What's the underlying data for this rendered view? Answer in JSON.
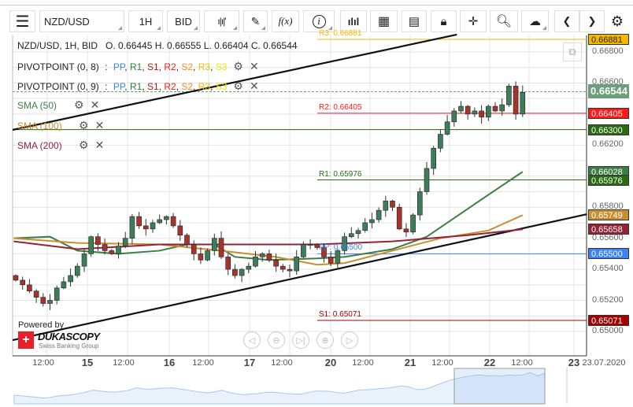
{
  "toolbar": {
    "symbol": "NZD/USD",
    "timeframe": "1H",
    "side": "BID",
    "fx": "f(x)",
    "info": "i",
    "prev": "❮",
    "next": "❯"
  },
  "legend": {
    "ohlc": "NZD/USD, 1H, BID   O. 0.66445 H. 0.66555 L. 0.66404 C. 0.66544",
    "pivots": [
      {
        "name": "PIVOTPOINT (0, 8)",
        "sep": " : ",
        "parts": [
          {
            "t": "PP",
            "c": "#3b82f6"
          },
          {
            "t": "R1",
            "c": "#2e7d32"
          },
          {
            "t": "S1",
            "c": "#b71c1c"
          },
          {
            "t": "R2",
            "c": "#ff1a1a"
          },
          {
            "t": "S2",
            "c": "#ff8c1a"
          },
          {
            "t": "R3",
            "c": "#f5b800"
          },
          {
            "t": "S3",
            "c": "#f2e600"
          }
        ]
      },
      {
        "name": "PIVOTPOINT (0, 9)",
        "sep": " : ",
        "parts": [
          {
            "t": "PP",
            "c": "#3b82f6"
          },
          {
            "t": "R1",
            "c": "#2e7d32"
          },
          {
            "t": "S1",
            "c": "#b71c1c"
          },
          {
            "t": "R2",
            "c": "#ff1a1a"
          },
          {
            "t": "S2",
            "c": "#ff8c1a"
          },
          {
            "t": "R3",
            "c": "#f5b800"
          },
          {
            "t": "S3",
            "c": "#f2e600"
          }
        ]
      }
    ],
    "smas": [
      {
        "label": "SMA (50)",
        "color": "#3e7d46"
      },
      {
        "label": "SMA (100)",
        "color": "#c98f2e"
      },
      {
        "label": "SMA (200)",
        "color": "#962235"
      }
    ]
  },
  "branding": {
    "powered": "Powered by",
    "brand": "DUKASCOPY",
    "tagline": "Swiss Banking Group"
  },
  "chart_data": {
    "type": "candlestick",
    "symbol": "NZD/USD",
    "timeframe": "1H",
    "side": "BID",
    "ylim": [
      0.649,
      0.6695
    ],
    "y_ticks": [
      "0.66800",
      "0.66600",
      "0.66200",
      "0.65800",
      "0.65600",
      "0.65400",
      "0.65200",
      "0.65000"
    ],
    "y_tick_values": [
      0.668,
      0.666,
      0.662,
      0.658,
      0.656,
      0.654,
      0.652,
      0.65
    ],
    "x_ticks": [
      {
        "t": "12:00",
        "d": false
      },
      {
        "t": "15",
        "d": true
      },
      {
        "t": "12:00",
        "d": false
      },
      {
        "t": "16",
        "d": true
      },
      {
        "t": "12:00",
        "d": false
      },
      {
        "t": "17",
        "d": true
      },
      {
        "t": "12:00",
        "d": false
      },
      {
        "t": "20",
        "d": true
      },
      {
        "t": "12:00",
        "d": false
      },
      {
        "t": "21",
        "d": true
      },
      {
        "t": "12:00",
        "d": false
      },
      {
        "t": "22",
        "d": true
      },
      {
        "t": "12:00",
        "d": false
      },
      {
        "t": "23",
        "d": true
      }
    ],
    "date_label": "23.07.2020",
    "closes": [
      0.6533,
      0.653,
      0.6526,
      0.6522,
      0.6518,
      0.652,
      0.6528,
      0.6532,
      0.6536,
      0.6542,
      0.655,
      0.6561,
      0.6556,
      0.6552,
      0.655,
      0.6555,
      0.656,
      0.6574,
      0.6568,
      0.6566,
      0.657,
      0.6572,
      0.6574,
      0.6568,
      0.6562,
      0.6556,
      0.655,
      0.6546,
      0.6552,
      0.656,
      0.6548,
      0.654,
      0.6536,
      0.654,
      0.6542,
      0.6548,
      0.655,
      0.6546,
      0.6542,
      0.654,
      0.6539,
      0.6548,
      0.6556,
      0.6556,
      0.6554,
      0.6548,
      0.6544,
      0.6552,
      0.6561,
      0.6563,
      0.6565,
      0.657,
      0.6572,
      0.6578,
      0.6584,
      0.658,
      0.6566,
      0.6564,
      0.6575,
      0.659,
      0.6605,
      0.6618,
      0.6627,
      0.6635,
      0.6642,
      0.6645,
      0.664,
      0.6642,
      0.6638,
      0.6645,
      0.6642,
      0.6646,
      0.6658,
      0.664,
      0.6654
    ],
    "last_price": "0.66544",
    "sma": [
      {
        "name": "SMA (50)",
        "color": "#3e7d46",
        "points": [
          [
            -0.3,
            0.656
          ],
          [
            5,
            0.6561
          ],
          [
            9,
            0.6552
          ],
          [
            15,
            0.655
          ],
          [
            21,
            0.6552
          ],
          [
            25,
            0.6556
          ],
          [
            29,
            0.6556
          ],
          [
            32,
            0.6548
          ],
          [
            37,
            0.6546
          ],
          [
            44,
            0.6547
          ],
          [
            48,
            0.6548
          ],
          [
            55,
            0.6553
          ],
          [
            60,
            0.6561
          ],
          [
            64,
            0.6573
          ],
          [
            69,
            0.6588
          ],
          [
            74,
            0.66028
          ]
        ]
      },
      {
        "name": "SMA (100)",
        "color": "#c98f2e",
        "points": [
          [
            -0.3,
            0.656
          ],
          [
            9,
            0.6557
          ],
          [
            21,
            0.6556
          ],
          [
            30,
            0.6552
          ],
          [
            38,
            0.6548
          ],
          [
            44,
            0.6543
          ],
          [
            48,
            0.6544
          ],
          [
            55,
            0.6552
          ],
          [
            62,
            0.656
          ],
          [
            69,
            0.6565
          ],
          [
            74,
            0.65749
          ]
        ]
      },
      {
        "name": "SMA (200)",
        "color": "#962235",
        "points": [
          [
            -0.3,
            0.6558
          ],
          [
            9,
            0.6553
          ],
          [
            21,
            0.6556
          ],
          [
            33,
            0.6556
          ],
          [
            44,
            0.6556
          ],
          [
            55,
            0.6558
          ],
          [
            66,
            0.6562
          ],
          [
            74,
            0.65658
          ]
        ]
      }
    ],
    "trendlines": [
      {
        "points": [
          [
            -0.46,
            0.66298
          ],
          [
            64.4,
            0.66912
          ]
        ]
      },
      {
        "points": [
          [
            -0.46,
            0.64944
          ],
          [
            83.4,
            0.65755
          ]
        ]
      }
    ],
    "levels": [
      {
        "label": "R3: 0.66881",
        "value": 0.66881,
        "badge": "0.66881",
        "color": "#f5b800",
        "text": "#222",
        "full": false
      },
      {
        "label": "R2: 0.66405",
        "value": 0.66405,
        "badge": "0.66405",
        "color": "#ff1a1a",
        "text": "#fff",
        "full": false
      },
      {
        "label": "",
        "value": 0.663,
        "badge": "0.66300",
        "color": "#2a6a10",
        "text": "#fff",
        "full": true
      },
      {
        "label": "",
        "value": 0.66028,
        "badge": "0.66028",
        "color": "#3e7d46",
        "text": "#fff",
        "full": false,
        "noline": true
      },
      {
        "label": "R1: 0.65976",
        "value": 0.65976,
        "badge": "0.65976",
        "color": "#2a6a10",
        "text": "#fff",
        "full": false
      },
      {
        "label": "",
        "value": 0.65749,
        "badge": "0.65749",
        "color": "#c98f2e",
        "text": "#fff",
        "full": false,
        "noline": true
      },
      {
        "label": "",
        "value": 0.65658,
        "badge": "0.65658",
        "color": "#962235",
        "text": "#fff",
        "full": false,
        "noline": true
      },
      {
        "label": "PP: 0.65500",
        "value": 0.655,
        "badge": "0.65500",
        "color": "#3b82f6",
        "text": "#fff",
        "full": false
      },
      {
        "label": "S1: 0.65071",
        "value": 0.65071,
        "badge": "0.65071",
        "color": "#a50000",
        "text": "#fff",
        "full": false
      }
    ]
  }
}
